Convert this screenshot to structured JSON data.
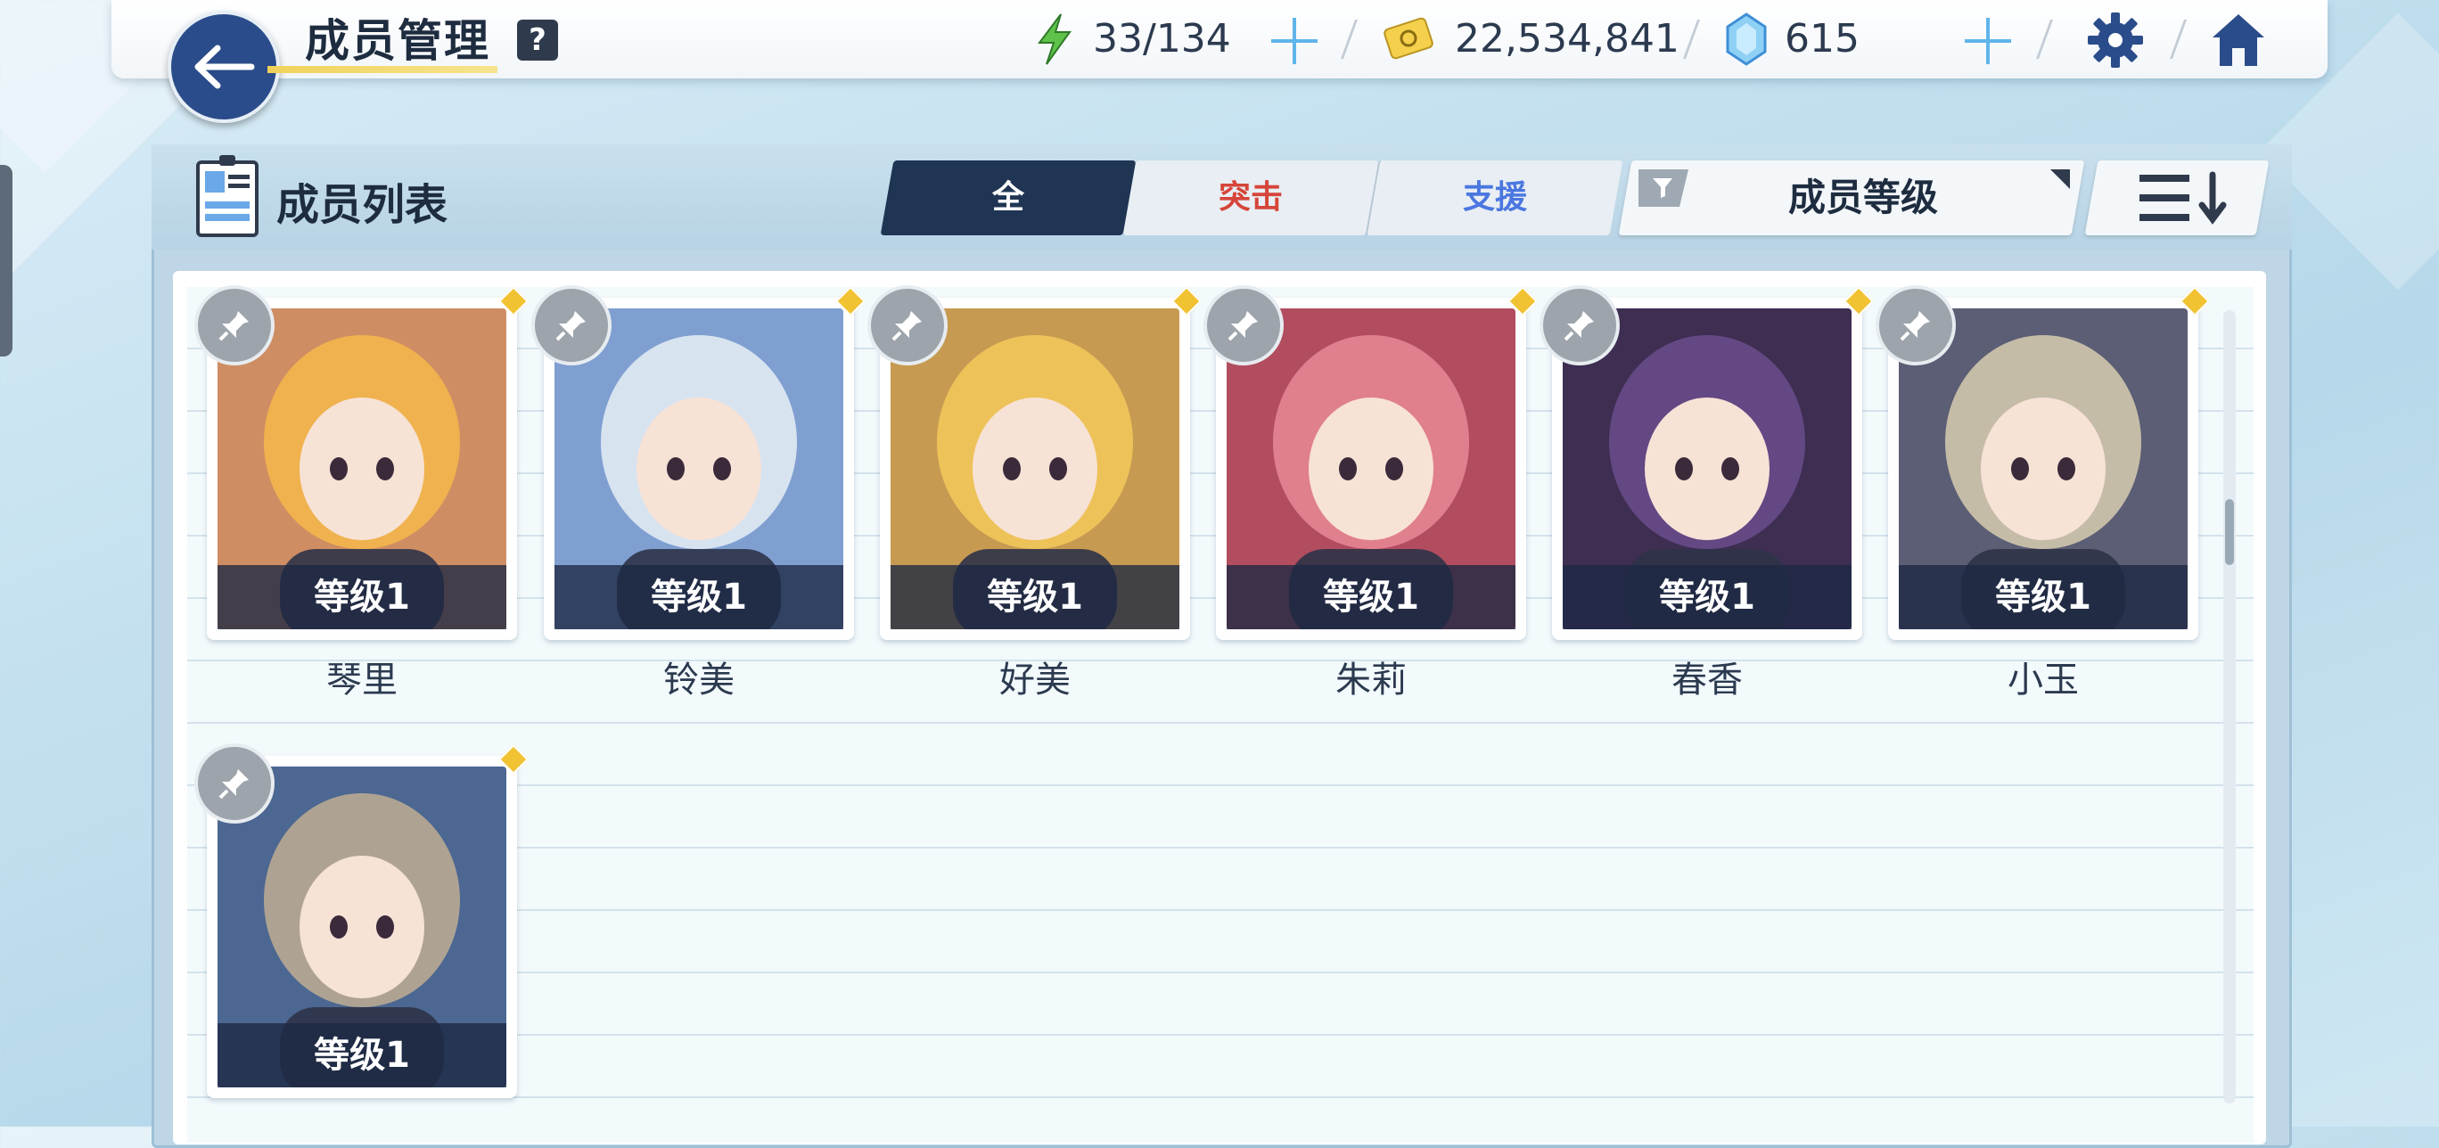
{
  "header": {
    "title": "成员管理",
    "help_label": "?",
    "ap": "33/134",
    "credits": "22,534,841",
    "gems": "615"
  },
  "panel": {
    "title": "成员列表",
    "tabs": [
      {
        "label": "全",
        "active": true,
        "color": "#ffffff"
      },
      {
        "label": "突击",
        "active": false,
        "color": "#d6453a"
      },
      {
        "label": "支援",
        "active": false,
        "color": "#4b77e0"
      }
    ],
    "sort_label": "成员等级"
  },
  "members": [
    {
      "name": "琴里",
      "level": "等级1",
      "bg": "#cf8d63",
      "accent": "#f4b84a"
    },
    {
      "name": "铃美",
      "level": "等级1",
      "bg": "#7f9fd1",
      "accent": "#e8eef6"
    },
    {
      "name": "好美",
      "level": "等级1",
      "bg": "#c79a52",
      "accent": "#f3c95b"
    },
    {
      "name": "朱莉",
      "level": "等级1",
      "bg": "#b24d60",
      "accent": "#e88897"
    },
    {
      "name": "春香",
      "level": "等级1",
      "bg": "#3d2e52",
      "accent": "#6b4c8c"
    },
    {
      "name": "小玉",
      "level": "等级1",
      "bg": "#5b5e74",
      "accent": "#d8ccb1"
    },
    {
      "name": "",
      "level": "等级1",
      "bg": "#4c6791",
      "accent": "#bfae93"
    }
  ]
}
